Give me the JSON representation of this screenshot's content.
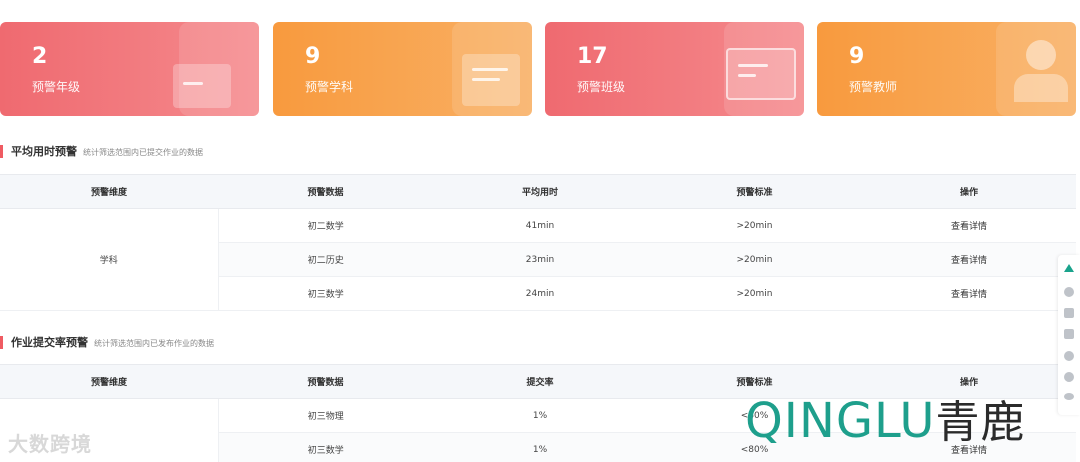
{
  "cards": [
    {
      "value": "2",
      "label": "预警年级",
      "icon": "grade-cards-icon"
    },
    {
      "value": "9",
      "label": "预警学科",
      "icon": "subject-folder-icon"
    },
    {
      "value": "17",
      "label": "预警班级",
      "icon": "class-board-icon"
    },
    {
      "value": "9",
      "label": "预警教师",
      "icon": "teacher-icon"
    }
  ],
  "section1": {
    "title": "平均用时预警",
    "subtitle": "统计筛选范围内已提交作业的数据",
    "headers": [
      "预警维度",
      "预警数据",
      "平均用时",
      "预警标准",
      "操作"
    ],
    "dimension": "学科",
    "rows": [
      {
        "data": "初二数学",
        "value": "41min",
        "standard": ">20min",
        "action": "查看详情"
      },
      {
        "data": "初二历史",
        "value": "23min",
        "standard": ">20min",
        "action": "查看详情"
      },
      {
        "data": "初三数学",
        "value": "24min",
        "standard": ">20min",
        "action": "查看详情"
      }
    ]
  },
  "section2": {
    "title": "作业提交率预警",
    "subtitle": "统计筛选范围内已发布作业的数据",
    "headers": [
      "预警维度",
      "预警数据",
      "提交率",
      "预警标准",
      "操作"
    ],
    "rows": [
      {
        "data": "初三物理",
        "value": "1%",
        "standard": "<80%",
        "action": ""
      },
      {
        "data": "初三数学",
        "value": "1%",
        "standard": "<80%",
        "action": "查看详情"
      }
    ]
  },
  "sidebar": {
    "icons": [
      "back-to-top-icon",
      "clock-icon",
      "document-icon",
      "notebook-icon",
      "check-icon",
      "user-icon",
      "eye-icon"
    ]
  },
  "watermark": {
    "left": "大数跨境",
    "brand": "QINGLU",
    "brand_cn": "青鹿"
  }
}
